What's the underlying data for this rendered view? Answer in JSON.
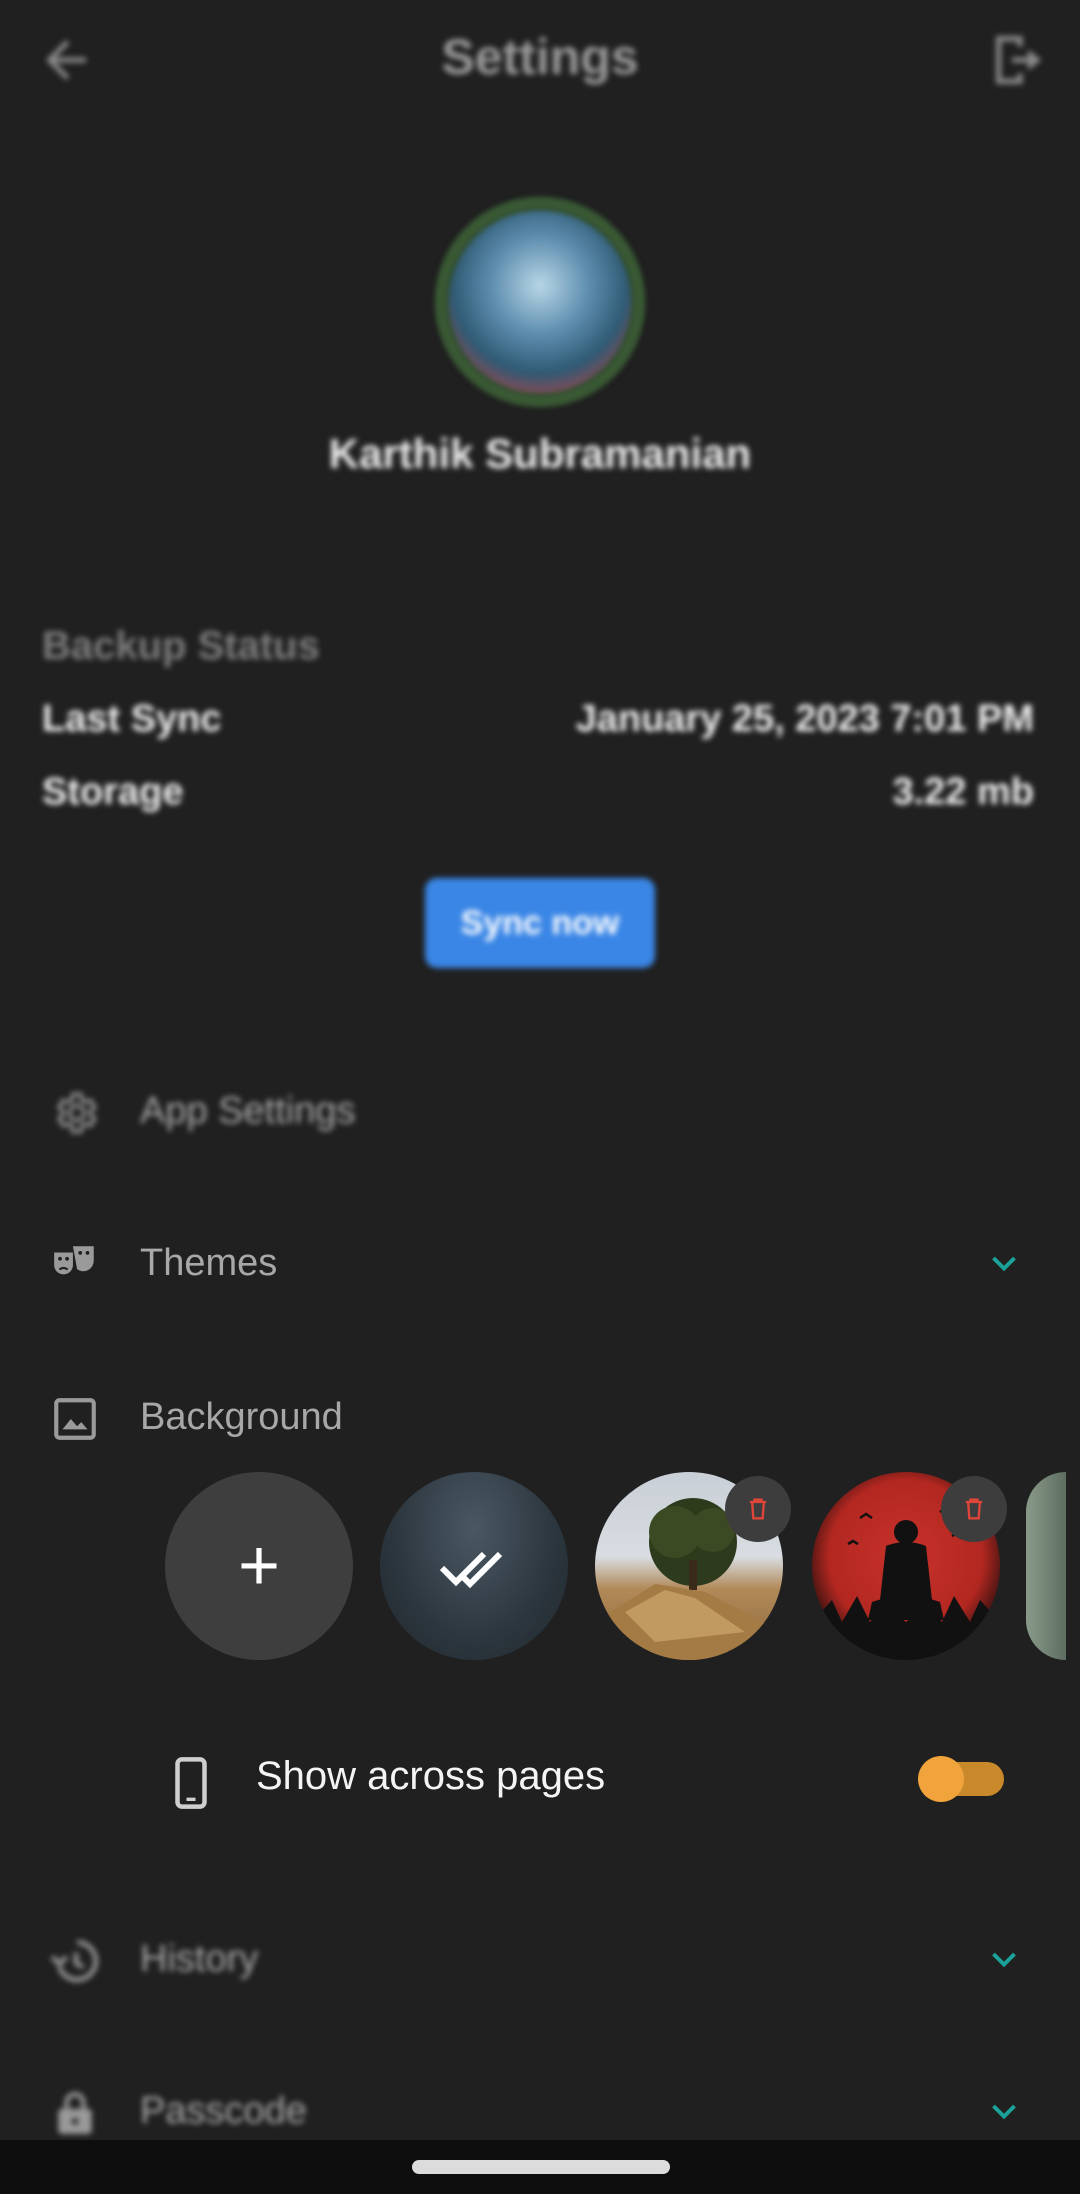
{
  "header": {
    "title": "Settings",
    "back_icon": "arrow-left-icon",
    "logout_icon": "logout-icon"
  },
  "profile": {
    "name": "Karthik Subramanian"
  },
  "backup": {
    "title": "Backup Status",
    "rows": [
      {
        "label": "Last Sync",
        "value": "January 25, 2023 7:01 PM"
      },
      {
        "label": "Storage",
        "value": "3.22 mb"
      }
    ],
    "sync_button": "Sync now"
  },
  "menu": {
    "app_settings": {
      "label": "App Settings",
      "icon": "gear-icon"
    },
    "themes": {
      "label": "Themes",
      "icon": "theater-masks-icon",
      "expanded": false
    },
    "background": {
      "label": "Background",
      "icon": "image-icon"
    },
    "history": {
      "label": "History",
      "icon": "history-icon",
      "expanded": false
    },
    "passcode": {
      "label": "Passcode",
      "icon": "lock-icon",
      "expanded": false
    }
  },
  "background_options": {
    "add_label": "+",
    "items": [
      "add",
      "dark-sky-selected",
      "tree-on-rock",
      "red-moon-silhouette",
      "partial-next"
    ]
  },
  "show_across_pages": {
    "label": "Show across pages",
    "icon": "phone-icon",
    "enabled": true
  },
  "colors": {
    "background": "#202020",
    "accent_blue": "#3a86e6",
    "chevron_teal": "#1aa29a",
    "toggle_orange": "#f0a43b",
    "delete_red": "#e0453a"
  }
}
